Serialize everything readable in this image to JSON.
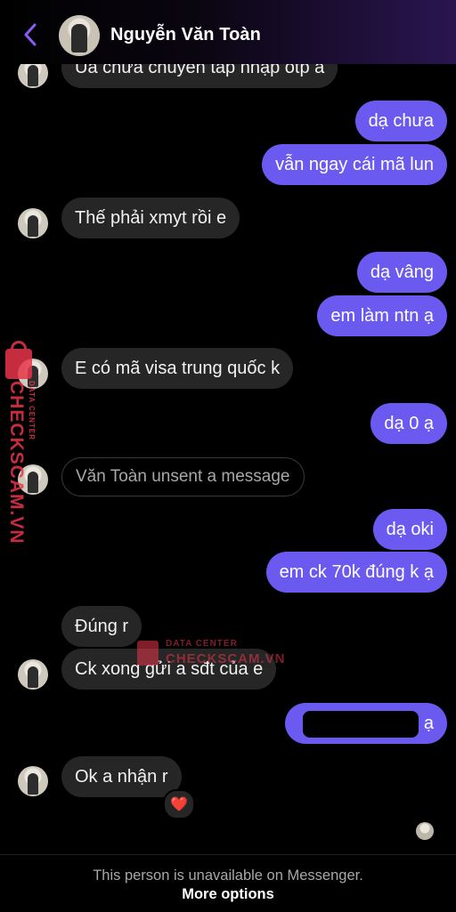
{
  "header": {
    "contact_name": "Nguyễn Văn Toàn",
    "back_icon": "chevron-left-icon",
    "accent_color": "#8b5cf6"
  },
  "messages": [
    {
      "from": "them",
      "text": "Ua chưa chuyên tap nhập otp à"
    },
    {
      "from": "me",
      "text": "dạ chưa"
    },
    {
      "from": "me",
      "text": "vẫn ngay cái mã lun"
    },
    {
      "from": "them",
      "text": "Thế phải xmyt rồi e"
    },
    {
      "from": "me",
      "text": "dạ vâng"
    },
    {
      "from": "me",
      "text": "em làm ntn ạ"
    },
    {
      "from": "them",
      "text": "E có mã visa trung quốc k"
    },
    {
      "from": "me",
      "text": "dạ 0 ạ"
    },
    {
      "from": "them",
      "text": "Văn Toàn unsent a message",
      "unsent": true
    },
    {
      "from": "me",
      "text": "dạ oki"
    },
    {
      "from": "me",
      "text": "em ck 70k đúng k ạ"
    },
    {
      "from": "them",
      "text": "Đúng r"
    },
    {
      "from": "them",
      "text": "Ck xong gửi a sđt của e"
    },
    {
      "from": "me",
      "text": "ạ",
      "redacted": true
    },
    {
      "from": "them",
      "text": "Ok a nhận r",
      "reaction": "❤️"
    }
  ],
  "watermark": {
    "brand": "CHECKSCAM.VN",
    "tagline": "DATA CENTER"
  },
  "footer": {
    "status": "This person is unavailable on Messenger.",
    "more_options": "More options"
  },
  "colors": {
    "outgoing_bubble": "#6b5af0",
    "incoming_bubble": "#262626",
    "background": "#000000"
  }
}
